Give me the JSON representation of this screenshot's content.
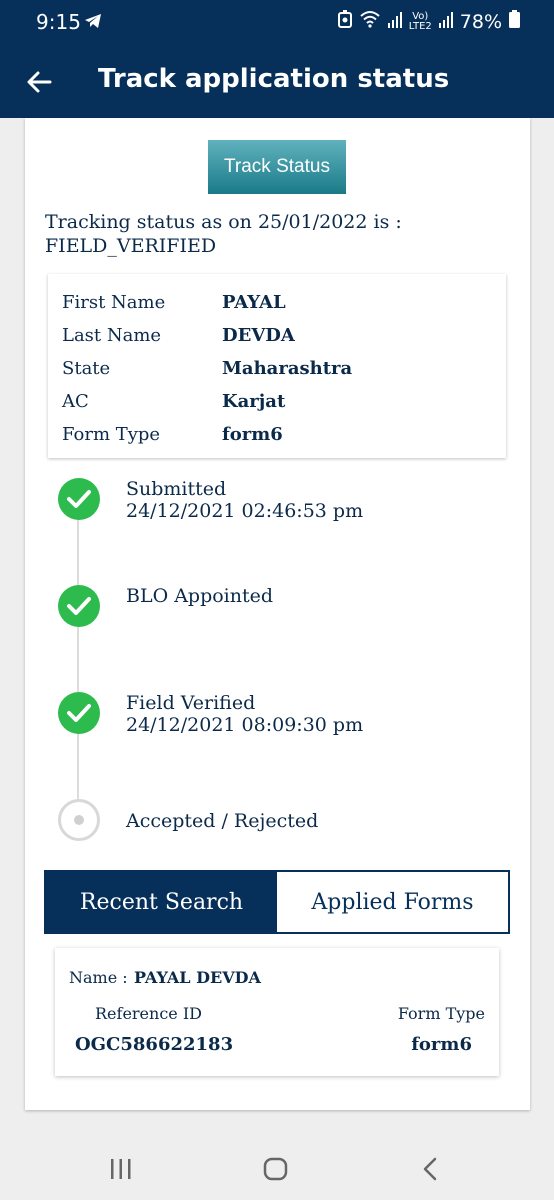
{
  "status_bar": {
    "time": "9:15",
    "volte_top": "Vo)",
    "volte_bottom": "LTE2",
    "battery": "78%",
    "icons": [
      "telegram-icon",
      "alarm-icon",
      "wifi-icon",
      "signal-icon",
      "battery-icon"
    ]
  },
  "app_bar": {
    "title": "Track application status",
    "back_icon": "arrow-left-icon"
  },
  "track_button": "Track Status",
  "tracking_status": {
    "line1": "Tracking status as on 25/01/2022 is :",
    "line2": "FIELD_VERIFIED"
  },
  "details": [
    {
      "label": "First Name",
      "value": "PAYAL"
    },
    {
      "label": "Last Name",
      "value": "DEVDA"
    },
    {
      "label": "State",
      "value": "Maharashtra"
    },
    {
      "label": "AC",
      "value": "Karjat"
    },
    {
      "label": "Form Type",
      "value": "form6"
    }
  ],
  "timeline": [
    {
      "title": "Submitted",
      "timestamp": "24/12/2021 02:46:53 pm",
      "status": "done"
    },
    {
      "title": "BLO Appointed",
      "timestamp": "",
      "status": "done"
    },
    {
      "title": "Field Verified",
      "timestamp": "24/12/2021 08:09:30 pm",
      "status": "done"
    },
    {
      "title": "Accepted / Rejected",
      "timestamp": "",
      "status": "pending"
    }
  ],
  "tabs": [
    {
      "label": "Recent Search",
      "active": true
    },
    {
      "label": "Applied Forms",
      "active": false
    }
  ],
  "recent_search": {
    "name_label": "Name :",
    "name_value": "PAYAL DEVDA",
    "ref_label": "Reference ID",
    "ref_value": "OGC586622183",
    "form_label": "Form Type",
    "form_value": "form6"
  },
  "nav_bar": {
    "icons": [
      "recents-icon",
      "home-icon",
      "back-icon"
    ]
  },
  "colors": {
    "primary": "#06305a",
    "success": "#2dbb4d",
    "button_teal": "#1b7a88"
  }
}
